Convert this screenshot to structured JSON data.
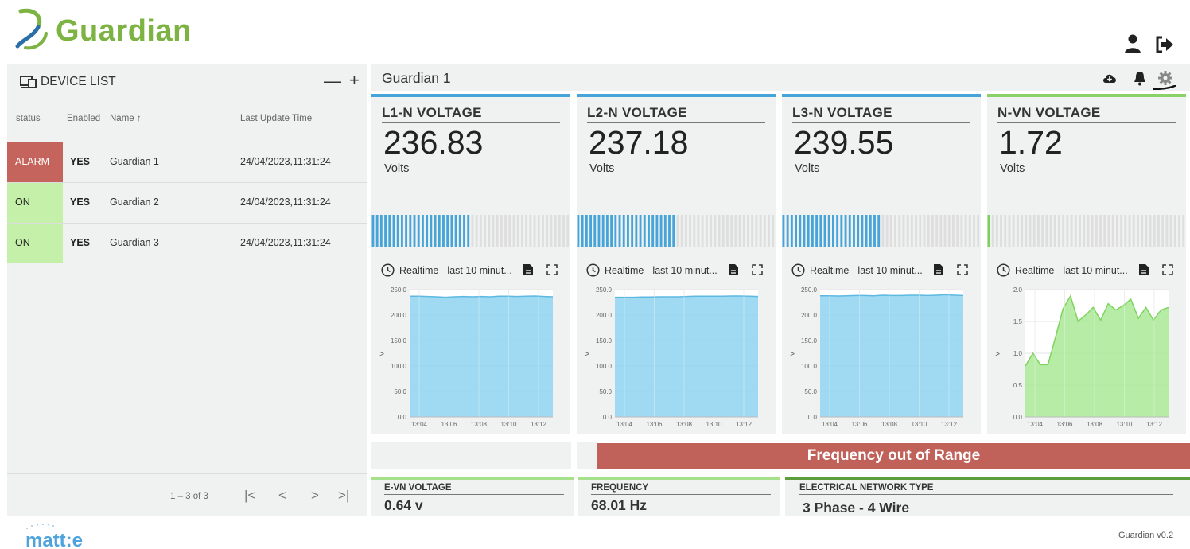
{
  "header": {
    "brand": "Guardian",
    "user_icon": "user-icon",
    "logout_icon": "logout-icon"
  },
  "device_list": {
    "title": "DEVICE LIST",
    "minus_label": "—",
    "plus_label": "+",
    "columns": [
      "status",
      "Enabled",
      "Name ↑",
      "Last Update Time"
    ],
    "rows": [
      {
        "status": "ALARM",
        "enabled": "YES",
        "name": "Guardian 1",
        "time": "24/04/2023,11:31:24"
      },
      {
        "status": "ON",
        "enabled": "YES",
        "name": "Guardian 2",
        "time": "24/04/2023,11:31:24"
      },
      {
        "status": "ON",
        "enabled": "YES",
        "name": "Guardian 3",
        "time": "24/04/2023,11:31:24"
      }
    ],
    "range": "1 – 3 of 3",
    "pager": [
      "|<",
      "<",
      ">",
      ">|"
    ]
  },
  "main": {
    "title": "Guardian 1",
    "icons": [
      "cloud-download-icon",
      "bell-icon",
      "gear-icon"
    ]
  },
  "cards": [
    {
      "title": "L1-N VOLTAGE",
      "value": "236.83",
      "unit": "Volts",
      "realtime": "Realtime - last 10 minut...",
      "gauge_fraction": 0.49
    },
    {
      "title": "L2-N VOLTAGE",
      "value": "237.18",
      "unit": "Volts",
      "realtime": "Realtime - last 10 minut...",
      "gauge_fraction": 0.49
    },
    {
      "title": "L3-N VOLTAGE",
      "value": "239.55",
      "unit": "Volts",
      "realtime": "Realtime - last 10 minut...",
      "gauge_fraction": 0.49
    },
    {
      "title": "N-VN VOLTAGE",
      "value": "1.72",
      "unit": "Volts",
      "realtime": "Realtime - last 10 minut...",
      "gauge_fraction": 0.02
    }
  ],
  "chart_data": [
    {
      "type": "area",
      "ylabel": ">",
      "ylim": [
        0,
        250
      ],
      "yticks": [
        "0.0",
        "50.0",
        "100.0",
        "150.0",
        "200.0",
        "250.0"
      ],
      "xticks": [
        "13:04",
        "13:06",
        "13:08",
        "13:10",
        "13:12"
      ],
      "color": "#8ed3f0",
      "series": [
        {
          "values": [
            237,
            237,
            236.5,
            236,
            235,
            236,
            236.5,
            236,
            236.5,
            236,
            237,
            237,
            236.5,
            237,
            237.5,
            236.5,
            236
          ]
        }
      ]
    },
    {
      "type": "area",
      "ylabel": ">",
      "ylim": [
        0,
        250
      ],
      "yticks": [
        "0.0",
        "50.0",
        "100.0",
        "150.0",
        "200.0",
        "250.0"
      ],
      "xticks": [
        "13:04",
        "13:06",
        "13:08",
        "13:10",
        "13:12"
      ],
      "color": "#8ed3f0",
      "series": [
        {
          "values": [
            235,
            235,
            235,
            235.5,
            235.5,
            236,
            236,
            236,
            236.5,
            237,
            237,
            237,
            237,
            237.5,
            237.5,
            237,
            236.5
          ]
        }
      ]
    },
    {
      "type": "area",
      "ylabel": ">",
      "ylim": [
        0,
        250
      ],
      "yticks": [
        "0.0",
        "50.0",
        "100.0",
        "150.0",
        "200.0",
        "250.0"
      ],
      "xticks": [
        "13:04",
        "13:06",
        "13:08",
        "13:10",
        "13:12"
      ],
      "color": "#8ed3f0",
      "series": [
        {
          "values": [
            238,
            238,
            237.5,
            238,
            238.5,
            238.5,
            238,
            239,
            238.5,
            238.5,
            239,
            239,
            238.5,
            239,
            240,
            239,
            238.5
          ]
        }
      ]
    },
    {
      "type": "area",
      "ylabel": ">",
      "ylim": [
        0,
        2.0
      ],
      "yticks": [
        "0.0",
        "0.5",
        "1.0",
        "1.5",
        "2.0"
      ],
      "xticks": [
        "13:04",
        "13:06",
        "13:08",
        "13:10",
        "13:12"
      ],
      "color": "#a9e996",
      "series": [
        {
          "values": [
            0.8,
            1.0,
            0.82,
            0.82,
            1.25,
            1.7,
            1.9,
            1.5,
            1.6,
            1.72,
            1.52,
            1.78,
            1.68,
            1.75,
            1.85,
            1.55,
            1.72,
            1.52,
            1.68,
            1.72
          ]
        }
      ]
    }
  ],
  "alert": {
    "text": "Frequency out of Range"
  },
  "info": [
    {
      "label": "E-VN VOLTAGE",
      "value": "0.64 v"
    },
    {
      "label": "FREQUENCY",
      "value": "68.01 Hz"
    },
    {
      "label": "ELECTRICAL NETWORK TYPE",
      "value": "3 Phase - 4 Wire"
    }
  ],
  "footer": {
    "vendor": "matt:e",
    "version": "Guardian v0.2"
  },
  "colors": {
    "brand_green": "#7cb342",
    "alarm_red": "#c5645c",
    "on_green": "#c4f0a9",
    "chart_blue": "#8ed3f0",
    "chart_green": "#a9e996",
    "accent_blue": "#46a4d9"
  }
}
